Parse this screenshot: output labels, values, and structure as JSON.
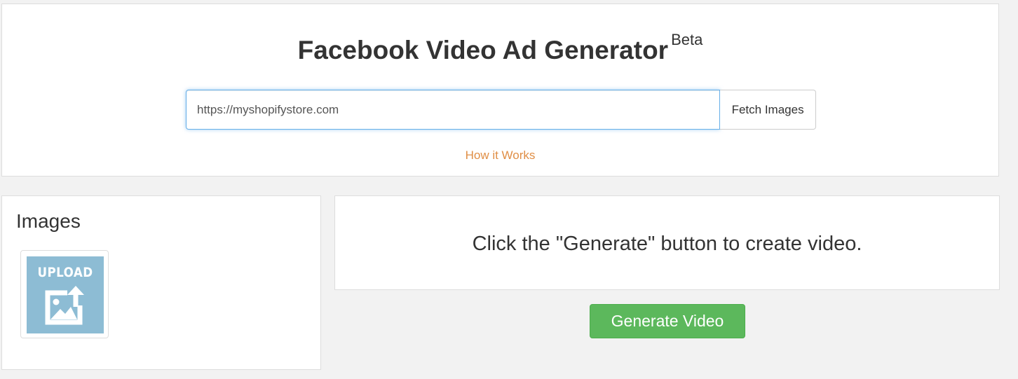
{
  "header": {
    "title": "Facebook Video Ad Generator",
    "badge": "Beta"
  },
  "url_form": {
    "input_value": "https://myshopifystore.com",
    "fetch_button_label": "Fetch Images"
  },
  "how_it_works_label": "How it Works",
  "images_panel": {
    "heading": "Images",
    "upload_tile": {
      "label": "UPLOAD",
      "icon": "image-upload-icon"
    }
  },
  "message": "Click the \"Generate\" button to create video.",
  "generate_button_label": "Generate Video",
  "colors": {
    "page_background": "#f2f2f2",
    "link": "#e08e45",
    "primary_success": "#5cb85c",
    "upload_tile": "#8dbcd4",
    "input_focus_border": "#66afe9"
  }
}
